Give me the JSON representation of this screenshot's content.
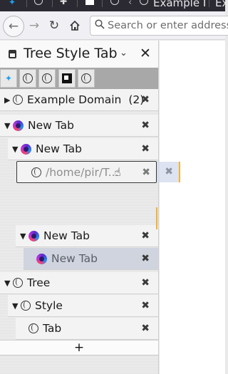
{
  "tabstrip": {
    "tabs": [
      {
        "label": "Example I",
        "icon": "globe-icon"
      },
      {
        "label": "Ex",
        "icon": "globe-icon"
      }
    ]
  },
  "navbar": {
    "back_icon": "back-arrow-icon",
    "forward_icon": "forward-arrow-icon",
    "reload_icon": "reload-icon",
    "home_icon": "home-icon",
    "url_placeholder": "Search or enter address"
  },
  "sidebar": {
    "title": "Tree Style Tab",
    "chevron": "⌄",
    "close": "✕",
    "pinned": [
      {
        "icon": "twitter-icon"
      },
      {
        "icon": "globe-icon"
      },
      {
        "icon": "globe-icon"
      },
      {
        "icon": "black-square-icon"
      },
      {
        "icon": "globe-icon"
      }
    ],
    "tree": [
      {
        "label": "Example Domain",
        "counter": "(2)",
        "twisty": "▶",
        "icon": "globe"
      },
      {
        "label": "New Tab",
        "twisty": "▼",
        "icon": "firefox"
      },
      {
        "label": "New Tab",
        "twisty": "▼",
        "icon": "firefox"
      },
      {
        "label": "New Tab",
        "twisty": "▼",
        "icon": "firefox"
      },
      {
        "label": "New Tab",
        "twisty": "",
        "icon": "firefox",
        "active": true
      },
      {
        "label": "Tree",
        "twisty": "▼",
        "icon": "globe"
      },
      {
        "label": "Style",
        "twisty": "▼",
        "icon": "globe"
      },
      {
        "label": "Tab",
        "twisty": "",
        "icon": "globe"
      }
    ],
    "drag_ghost_label": "/home/pir/T...",
    "new_tab_label": "+",
    "close_glyph": "✖"
  },
  "colors": {
    "accent": "#f2b233",
    "active_row": "#cfd4df",
    "pinned_bar": "#a8a8a8",
    "tabstrip": "#2b2a33"
  }
}
